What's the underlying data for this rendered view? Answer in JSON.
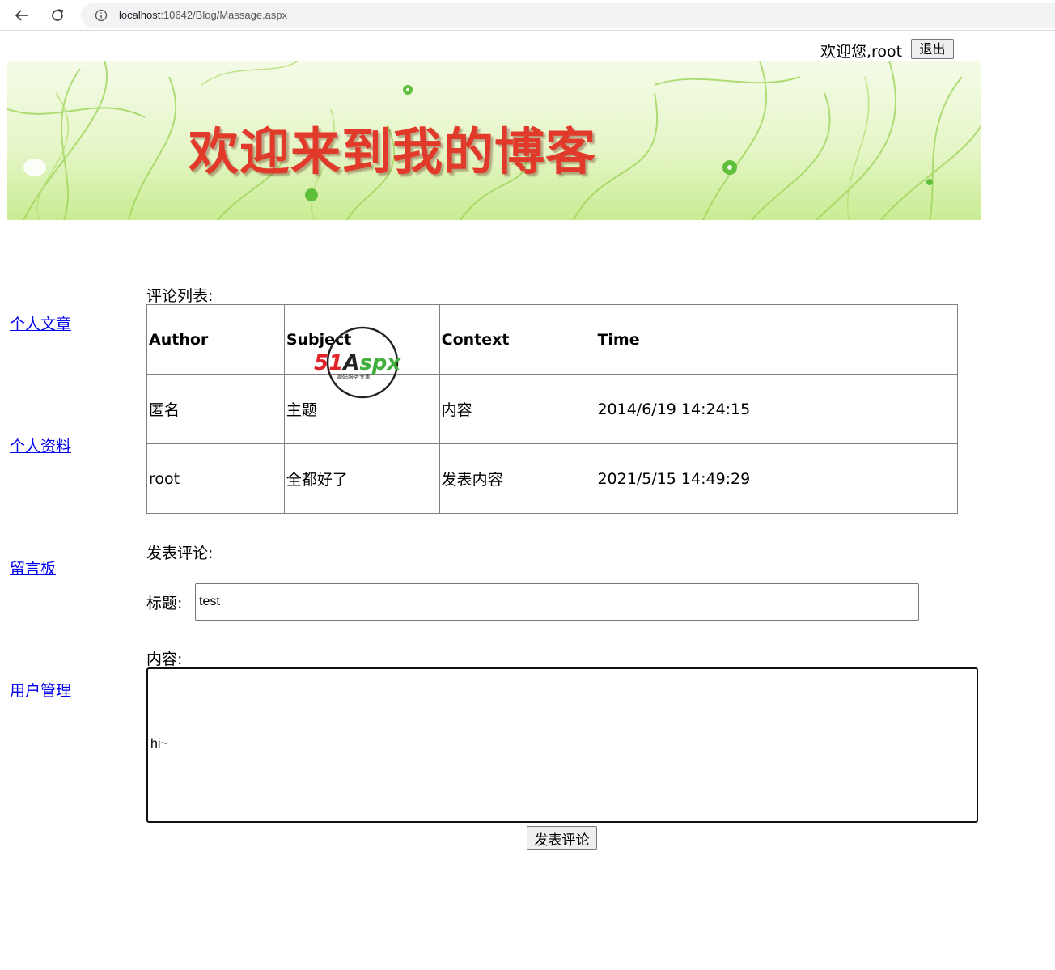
{
  "browser": {
    "url_host": "localhost",
    "url_path": ":10642/Blog/Massage.aspx"
  },
  "header": {
    "welcome_text": "欢迎您,root",
    "logout_label": "退出"
  },
  "banner": {
    "title": "欢迎来到我的博客"
  },
  "sidebar": {
    "items": [
      {
        "label": "个人文章"
      },
      {
        "label": "个人资料"
      },
      {
        "label": "留言板"
      },
      {
        "label": "用户管理"
      }
    ]
  },
  "comments": {
    "heading": "评论列表:",
    "columns": [
      "Author",
      "Subject",
      "Context",
      "Time"
    ],
    "rows": [
      [
        "匿名",
        "主题",
        "内容",
        "2014/6/19 14:24:15"
      ],
      [
        "root",
        "全都好了",
        "发表内容",
        "2021/5/15 14:49:29"
      ]
    ]
  },
  "form": {
    "heading": "发表评论:",
    "title_label": "标题:",
    "title_value": "test",
    "content_label": "内容:",
    "content_value": "hi~",
    "submit_label": "发表评论"
  },
  "watermark": {
    "brand": "51Aspx",
    "tagline": "源码服务专家"
  }
}
